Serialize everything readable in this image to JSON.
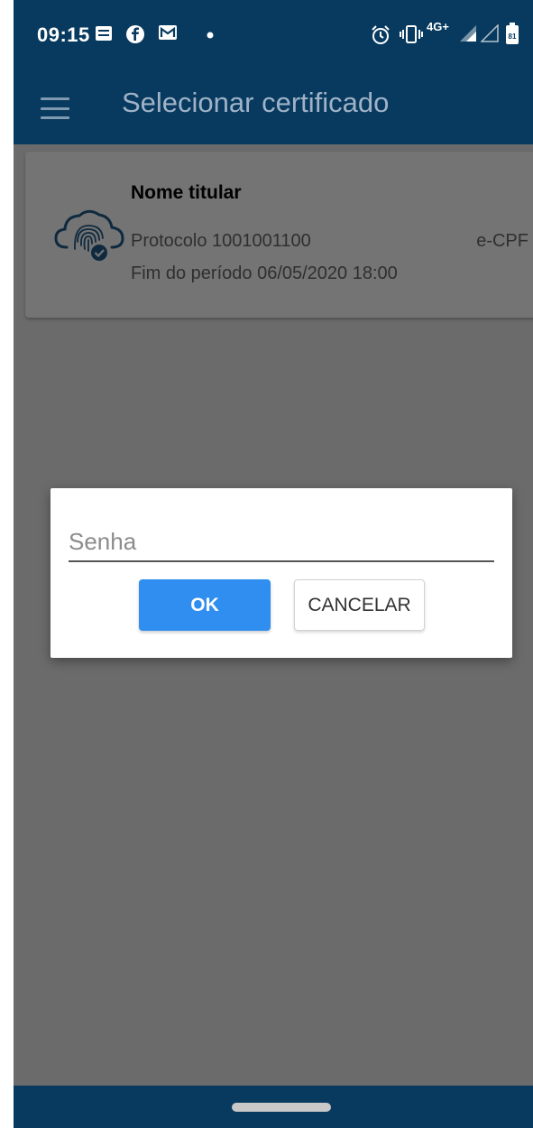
{
  "status_bar": {
    "time": "09:15",
    "network": "4G+",
    "battery": "81",
    "icons": [
      "notes-icon",
      "facebook-icon",
      "gmail-icon",
      "dot-icon",
      "alarm-icon",
      "vibrate-icon",
      "signal-icon",
      "signal-empty-icon",
      "battery-icon"
    ]
  },
  "app_bar": {
    "menu_icon": "hamburger-icon",
    "title": "Selecionar certificado"
  },
  "certificate": {
    "icon": "cloud-fingerprint-icon",
    "name": "Nome titular",
    "protocol": "Protocolo 1001001100",
    "type": "e-CPF",
    "end": "Fim do período 06/05/2020 18:00"
  },
  "dialog": {
    "password_placeholder": "Senha",
    "password_value": "",
    "ok_label": "OK",
    "cancel_label": "CANCELAR"
  },
  "colors": {
    "header": "#073a5e",
    "primary_button": "#2f8eef",
    "overlay": "#6b6b6b"
  }
}
